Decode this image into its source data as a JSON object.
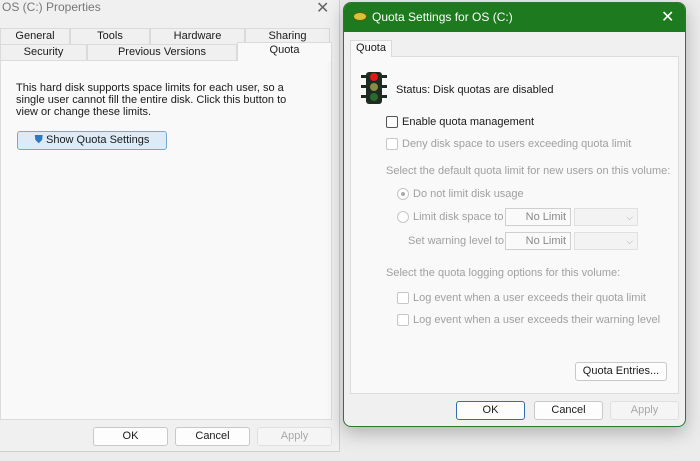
{
  "left_dialog": {
    "title": "OS (C:) Properties",
    "tabs_row1": [
      "General",
      "Tools",
      "Hardware",
      "Sharing"
    ],
    "tabs_row2": [
      "Security",
      "Previous Versions",
      "Quota"
    ],
    "description": "This hard disk supports space limits for each user, so a single user cannot fill the entire disk. Click this button to view or change these limits.",
    "show_quota_button": "Show Quota Settings",
    "ok": "OK",
    "cancel": "Cancel",
    "apply": "Apply"
  },
  "right_dialog": {
    "title": "Quota Settings for OS (C:)",
    "tab": "Quota",
    "status_label": "Status:",
    "status_value": "Disk quotas are disabled",
    "enable_quota": "Enable quota management",
    "deny_space": "Deny disk space to users exceeding quota limit",
    "default_limit_heading": "Select the default quota limit for new users on this volume:",
    "no_limit_radio": "Do not limit disk usage",
    "limit_radio": "Limit disk space to",
    "limit_value": "No Limit",
    "warning_label": "Set warning level to",
    "warning_value": "No Limit",
    "logging_heading": "Select the quota logging options for this volume:",
    "log_quota": "Log event when a user exceeds their quota limit",
    "log_warning": "Log event when a user exceeds their warning level",
    "quota_entries": "Quota Entries...",
    "ok": "OK",
    "cancel": "Cancel",
    "apply": "Apply",
    "title_color": "#1e7a1e"
  }
}
